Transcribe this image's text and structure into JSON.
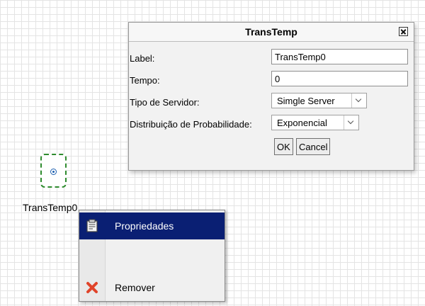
{
  "canvas": {
    "node_label": "TransTemp0"
  },
  "dialog": {
    "title": "TransTemp",
    "fields": [
      {
        "label": "Label:",
        "value": "TransTemp0"
      },
      {
        "label": "Tempo:",
        "value": "0"
      }
    ],
    "selects": [
      {
        "label": "Tipo de Servidor:",
        "value": "Simgle Server"
      },
      {
        "label": "Distribuição de Probabilidade:",
        "value": "Exponencial"
      }
    ],
    "ok_label": "OK",
    "cancel_label": "Cancel"
  },
  "context_menu": {
    "items": [
      {
        "label": "Propriedades",
        "icon": "properties-icon"
      },
      {
        "label": "",
        "icon": ""
      },
      {
        "label": "Remover",
        "icon": "remove-x-icon"
      }
    ]
  },
  "colors": {
    "node_border": "#2e8b2e",
    "menu_highlight": "#0a1f73",
    "remove_icon": "#e0442a"
  }
}
